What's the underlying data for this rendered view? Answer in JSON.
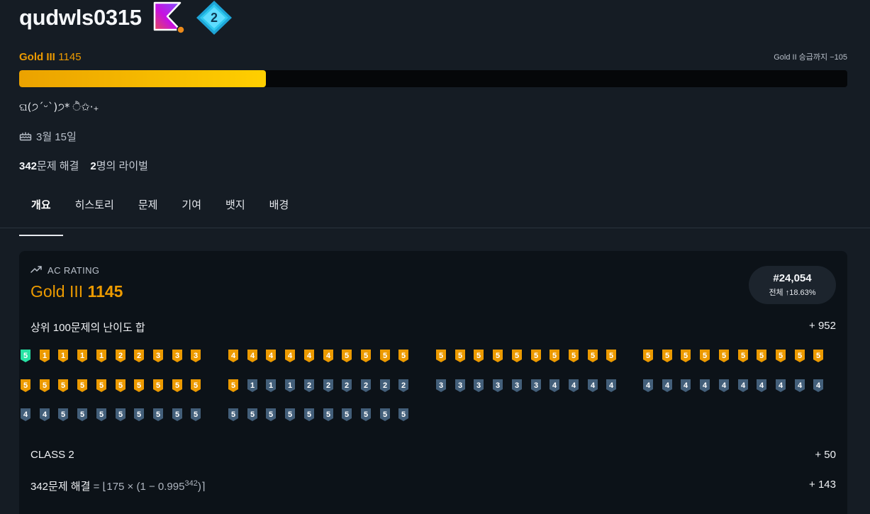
{
  "profile": {
    "username": "qudwls0315",
    "tier_name": "Gold III",
    "tier_rating": "1145",
    "promo_text": "Gold II 승급까지 −105",
    "progress_fraction": 0.298,
    "bio": "ଘ(੭ˊᵕˋ)੭* ੈ✩‧₊",
    "birthday": "3월 15일",
    "solved_count": "342",
    "solved_label": "문제 해결",
    "rival_count": "2",
    "rival_label": "명의 라이벌",
    "badge_number": "2"
  },
  "tabs": [
    {
      "label": "개요",
      "active": true
    },
    {
      "label": "히스토리",
      "active": false
    },
    {
      "label": "문제",
      "active": false
    },
    {
      "label": "기여",
      "active": false
    },
    {
      "label": "뱃지",
      "active": false
    },
    {
      "label": "배경",
      "active": false
    }
  ],
  "ac_rating": {
    "heading": "AC RATING",
    "tier": "Gold III",
    "value": "1145",
    "rank": "#24,054",
    "rank_sub": "전체 ↑18.63%",
    "top100_label": "상위 100문제의 난이도 합",
    "top100_value": "+ 952",
    "class_label": "CLASS 2",
    "class_value": "+ 50",
    "solved_formula_bold": "342문제 해결",
    "solved_formula_eq": " = ⌊175 × (1 − 0.995",
    "solved_formula_sup": "342",
    "solved_formula_end": ")⌉",
    "solved_value": "+ 143"
  },
  "problem_tiers": {
    "colors": {
      "platinum": "#27e2a4",
      "gold": "#ec9a00",
      "silver": "#435f7a"
    },
    "rows": [
      [
        [
          "platinum",
          "5"
        ],
        [
          "gold",
          "1"
        ],
        [
          "gold",
          "1"
        ],
        [
          "gold",
          "1"
        ],
        [
          "gold",
          "1"
        ],
        [
          "gold",
          "2"
        ],
        [
          "gold",
          "2"
        ],
        [
          "gold",
          "3"
        ],
        [
          "gold",
          "3"
        ],
        [
          "gold",
          "3"
        ],
        [
          "gold",
          "4"
        ],
        [
          "gold",
          "4"
        ],
        [
          "gold",
          "4"
        ],
        [
          "gold",
          "4"
        ],
        [
          "gold",
          "4"
        ],
        [
          "gold",
          "4"
        ],
        [
          "gold",
          "5"
        ],
        [
          "gold",
          "5"
        ],
        [
          "gold",
          "5"
        ],
        [
          "gold",
          "5"
        ],
        [
          "gold",
          "5"
        ],
        [
          "gold",
          "5"
        ],
        [
          "gold",
          "5"
        ],
        [
          "gold",
          "5"
        ],
        [
          "gold",
          "5"
        ],
        [
          "gold",
          "5"
        ],
        [
          "gold",
          "5"
        ],
        [
          "gold",
          "5"
        ],
        [
          "gold",
          "5"
        ],
        [
          "gold",
          "5"
        ],
        [
          "gold",
          "5"
        ],
        [
          "gold",
          "5"
        ],
        [
          "gold",
          "5"
        ],
        [
          "gold",
          "5"
        ],
        [
          "gold",
          "5"
        ],
        [
          "gold",
          "5"
        ],
        [
          "gold",
          "5"
        ],
        [
          "gold",
          "5"
        ],
        [
          "gold",
          "5"
        ],
        [
          "gold",
          "5"
        ]
      ],
      [
        [
          "gold",
          "5"
        ],
        [
          "gold",
          "5"
        ],
        [
          "gold",
          "5"
        ],
        [
          "gold",
          "5"
        ],
        [
          "gold",
          "5"
        ],
        [
          "gold",
          "5"
        ],
        [
          "gold",
          "5"
        ],
        [
          "gold",
          "5"
        ],
        [
          "gold",
          "5"
        ],
        [
          "gold",
          "5"
        ],
        [
          "gold",
          "5"
        ],
        [
          "silver",
          "1"
        ],
        [
          "silver",
          "1"
        ],
        [
          "silver",
          "1"
        ],
        [
          "silver",
          "2"
        ],
        [
          "silver",
          "2"
        ],
        [
          "silver",
          "2"
        ],
        [
          "silver",
          "2"
        ],
        [
          "silver",
          "2"
        ],
        [
          "silver",
          "2"
        ],
        [
          "silver",
          "3"
        ],
        [
          "silver",
          "3"
        ],
        [
          "silver",
          "3"
        ],
        [
          "silver",
          "3"
        ],
        [
          "silver",
          "3"
        ],
        [
          "silver",
          "3"
        ],
        [
          "silver",
          "4"
        ],
        [
          "silver",
          "4"
        ],
        [
          "silver",
          "4"
        ],
        [
          "silver",
          "4"
        ],
        [
          "silver",
          "4"
        ],
        [
          "silver",
          "4"
        ],
        [
          "silver",
          "4"
        ],
        [
          "silver",
          "4"
        ],
        [
          "silver",
          "4"
        ],
        [
          "silver",
          "4"
        ],
        [
          "silver",
          "4"
        ],
        [
          "silver",
          "4"
        ],
        [
          "silver",
          "4"
        ],
        [
          "silver",
          "4"
        ]
      ],
      [
        [
          "silver",
          "4"
        ],
        [
          "silver",
          "4"
        ],
        [
          "silver",
          "5"
        ],
        [
          "silver",
          "5"
        ],
        [
          "silver",
          "5"
        ],
        [
          "silver",
          "5"
        ],
        [
          "silver",
          "5"
        ],
        [
          "silver",
          "5"
        ],
        [
          "silver",
          "5"
        ],
        [
          "silver",
          "5"
        ],
        [
          "silver",
          "5"
        ],
        [
          "silver",
          "5"
        ],
        [
          "silver",
          "5"
        ],
        [
          "silver",
          "5"
        ],
        [
          "silver",
          "5"
        ],
        [
          "silver",
          "5"
        ],
        [
          "silver",
          "5"
        ],
        [
          "silver",
          "5"
        ],
        [
          "silver",
          "5"
        ],
        [
          "silver",
          "5"
        ]
      ]
    ]
  }
}
